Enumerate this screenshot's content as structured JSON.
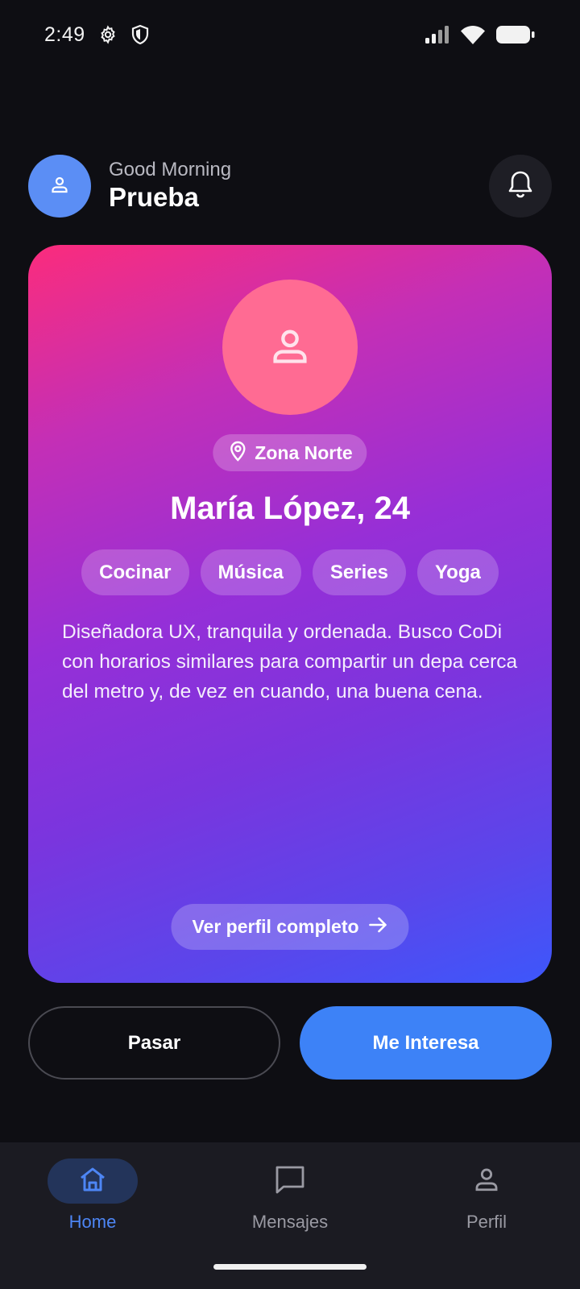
{
  "status_bar": {
    "time": "2:49",
    "left_icons": [
      "settings-gear-icon",
      "shield-icon"
    ],
    "right_icons": [
      "signal-icon",
      "wifi-icon",
      "battery-icon"
    ]
  },
  "header": {
    "greeting": "Good Morning",
    "username": "Prueba",
    "avatar_icon": "person-icon",
    "avatar_color": "#5b8ef5",
    "notification_icon": "bell-icon"
  },
  "profile_card": {
    "avatar_icon": "person-icon",
    "avatar_color": "#ff6b93",
    "location": "Zona Norte",
    "location_icon": "map-pin-icon",
    "name_age": "María López, 24",
    "tags": [
      "Cocinar",
      "Música",
      "Series",
      "Yoga"
    ],
    "bio": "Diseñadora UX, tranquila y ordenada. Busco CoDi con horarios similares para compartir un depa cerca del metro y, de vez en cuando, una buena cena.",
    "view_profile_label": "Ver perfil completo",
    "view_profile_icon": "arrow-right-icon",
    "gradient_colors": [
      "#fb2c7c",
      "#962fd7",
      "#3d57fb"
    ]
  },
  "actions": {
    "pass_label": "Pasar",
    "interest_label": "Me Interesa",
    "interest_color": "#3d82f7"
  },
  "bottom_nav": {
    "items": [
      {
        "label": "Home",
        "icon": "home-icon",
        "active": true
      },
      {
        "label": "Mensajes",
        "icon": "message-icon",
        "active": false
      },
      {
        "label": "Perfil",
        "icon": "person-icon",
        "active": false
      }
    ],
    "active_color": "#4d86f5"
  }
}
